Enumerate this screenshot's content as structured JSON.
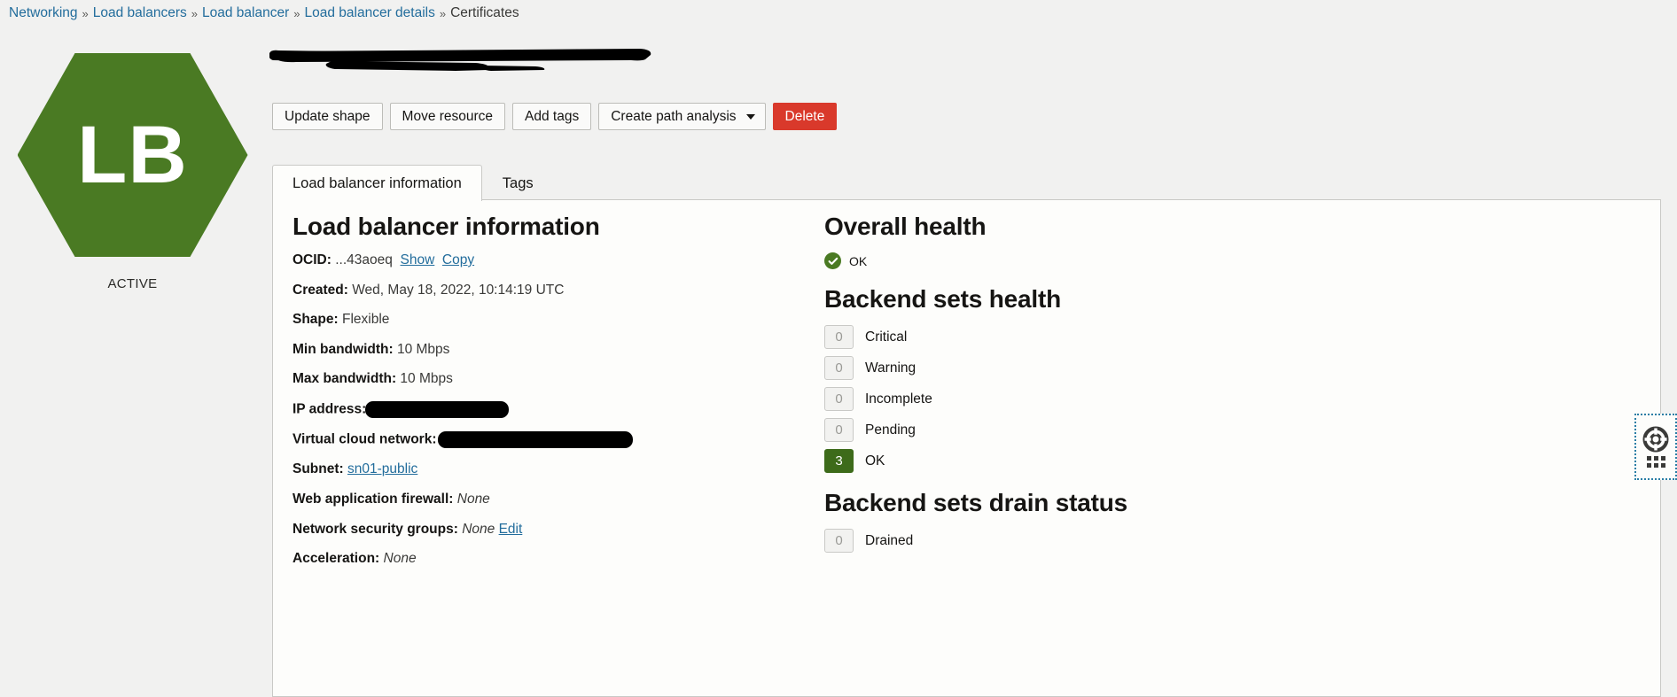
{
  "breadcrumb": {
    "separator": "»",
    "items": [
      {
        "label": "Networking",
        "link": true
      },
      {
        "label": "Load balancers",
        "link": true
      },
      {
        "label": "Load balancer",
        "link": true
      },
      {
        "label": "Load balancer details",
        "link": true
      },
      {
        "label": "Certificates",
        "link": false
      }
    ]
  },
  "resource": {
    "icon_label": "LB",
    "state": "ACTIVE",
    "title_redacted": true
  },
  "actions": {
    "update_shape": "Update shape",
    "move_resource": "Move resource",
    "add_tags": "Add tags",
    "create_path_analysis": "Create path analysis",
    "delete": "Delete",
    "delete_color": "#d9392b"
  },
  "tabs": [
    {
      "label": "Load balancer information",
      "active": true
    },
    {
      "label": "Tags",
      "active": false
    }
  ],
  "info": {
    "heading": "Load balancer information",
    "fields": [
      {
        "label": "OCID:",
        "value": "...43aoeq",
        "links": [
          "Show",
          "Copy"
        ]
      },
      {
        "label": "Created:",
        "value": "Wed, May 18, 2022, 10:14:19 UTC"
      },
      {
        "label": "Shape:",
        "value": "Flexible"
      },
      {
        "label": "Min bandwidth:",
        "value": "10 Mbps"
      },
      {
        "label": "Max bandwidth:",
        "value": "10 Mbps"
      },
      {
        "label": "IP address:",
        "value": "",
        "redacted": true
      },
      {
        "label": "Virtual cloud network:",
        "value": "",
        "redacted": true
      },
      {
        "label": "Subnet:",
        "value": "sn01-public",
        "value_is_link": true
      },
      {
        "label": "Web application firewall:",
        "value": "None",
        "italic": true
      },
      {
        "label": "Network security groups:",
        "value": "None",
        "italic": true,
        "links": [
          "Edit"
        ]
      },
      {
        "label": "Acceleration:",
        "value": "None",
        "italic": true
      }
    ]
  },
  "health": {
    "overall_heading": "Overall health",
    "overall_status": "OK",
    "overall_status_color": "#4a7a23",
    "backend_sets_heading": "Backend sets health",
    "backend_sets": [
      {
        "count": "0",
        "label": "Critical",
        "style": "zero"
      },
      {
        "count": "0",
        "label": "Warning",
        "style": "zero"
      },
      {
        "count": "0",
        "label": "Incomplete",
        "style": "zero"
      },
      {
        "count": "0",
        "label": "Pending",
        "style": "zero"
      },
      {
        "count": "3",
        "label": "OK",
        "style": "green"
      }
    ],
    "drain_heading": "Backend sets drain status",
    "drain": [
      {
        "count": "0",
        "label": "Drained",
        "style": "zero"
      }
    ]
  },
  "help_widget": {
    "icon": "life-ring-icon",
    "grid_icon": "dot-grid-icon"
  }
}
